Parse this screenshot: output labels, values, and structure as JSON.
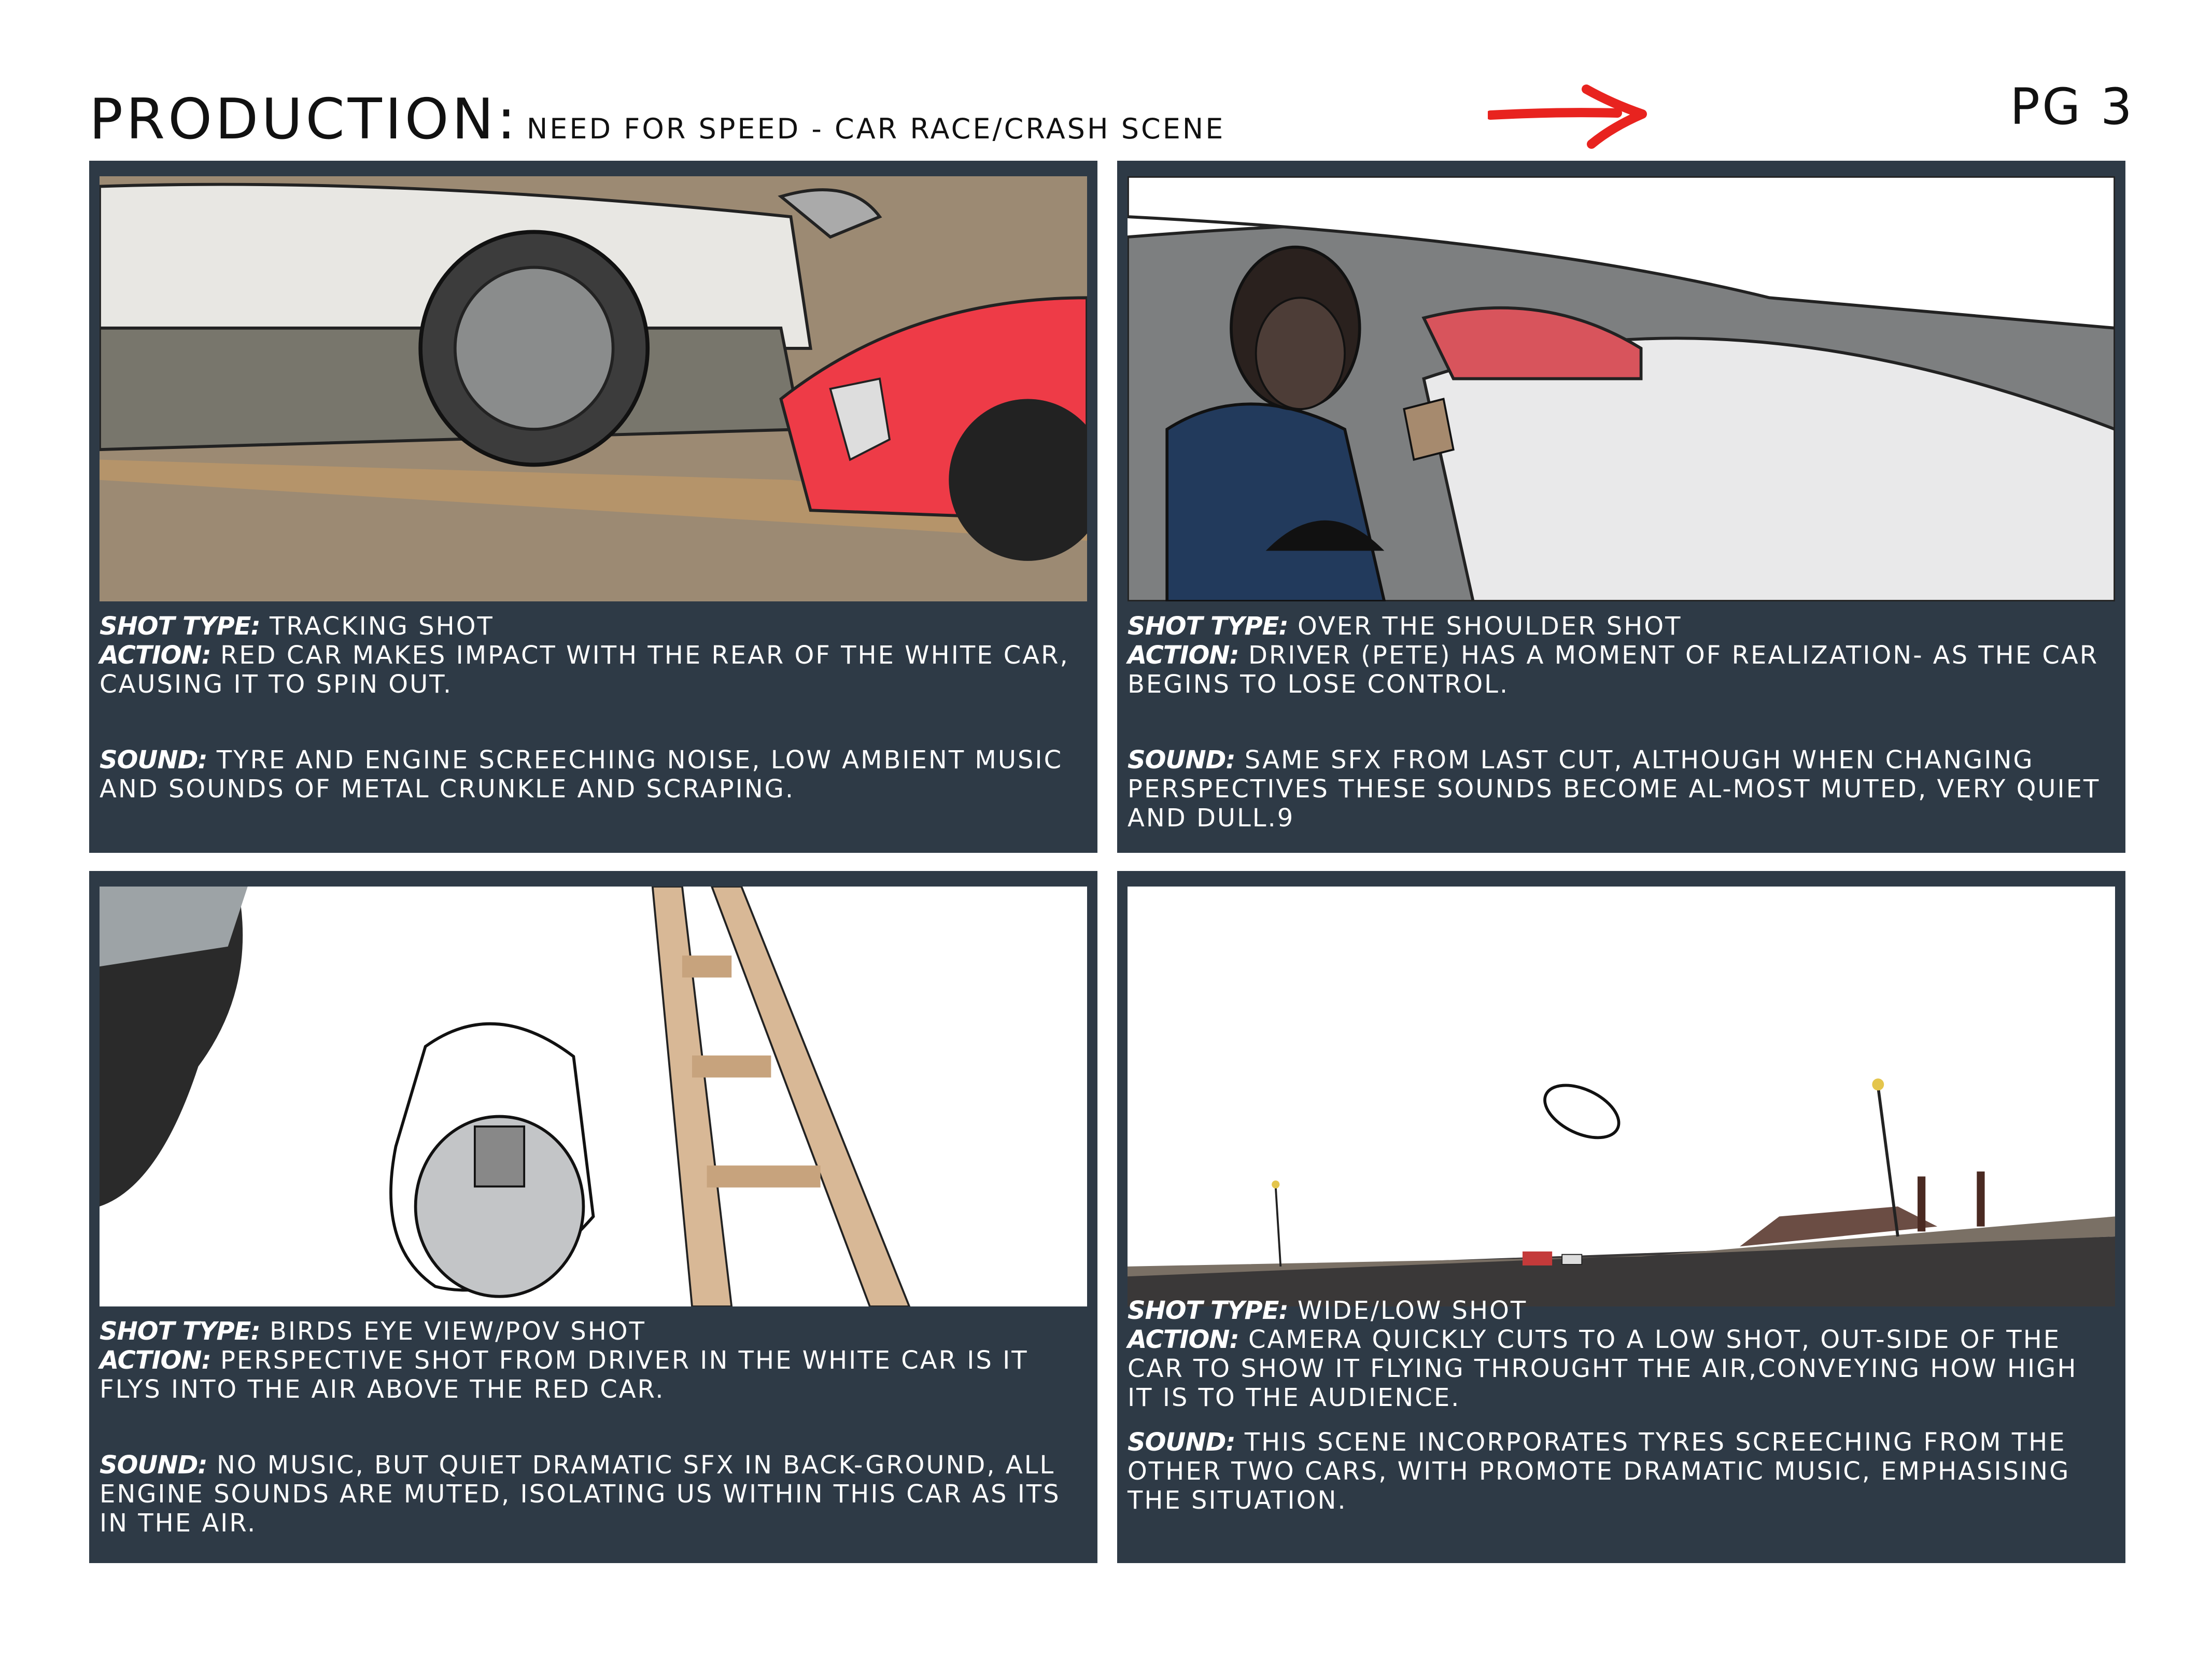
{
  "header": {
    "production_label": "PRODUCTION:",
    "scene_title": "NEED FOR SPEED - CAR RACE/CRASH SCENE",
    "page_number": "PG 3",
    "arrow_icon": "red-arrow-right-icon",
    "arrow_color": "#e8231f"
  },
  "labels": {
    "shot_type": "SHOT TYPE:",
    "action": "ACTION:",
    "sound": "SOUND:"
  },
  "panels": [
    {
      "shot_type": "TRACKING SHOT",
      "action": "RED CAR MAKES IMPACT WITH THE REAR OF THE WHITE CAR, CAUSING IT TO SPIN OUT.",
      "sound": "TYRE AND ENGINE SCREECHING NOISE, LOW AMBIENT MUSIC AND SOUNDS OF METAL CRUNKLE AND SCRAPING."
    },
    {
      "shot_type": "OVER THE SHOULDER SHOT",
      "action": "DRIVER (PETE) HAS A MOMENT OF REALIZATION- AS THE CAR BEGINS TO LOSE CONTROL.",
      "sound": "SAME SFX FROM LAST CUT,  ALTHOUGH WHEN CHANGING PERSPECTIVES THESE SOUNDS BECOME AL-MOST MUTED, VERY QUIET AND DULL.9"
    },
    {
      "shot_type": "BIRDS EYE VIEW/POV SHOT",
      "action": "PERSPECTIVE SHOT FROM DRIVER IN THE WHITE CAR IS IT FLYS INTO THE AIR ABOVE THE RED CAR.",
      "sound": "NO MUSIC, BUT QUIET DRAMATIC SFX IN BACK-GROUND, ALL ENGINE SOUNDS ARE MUTED, ISOLATING US WITHIN THIS CAR AS ITS IN THE AIR."
    },
    {
      "shot_type": "WIDE/LOW SHOT",
      "action": "CAMERA QUICKLY CUTS TO A LOW SHOT, OUT-SIDE OF THE CAR TO SHOW IT FLYING THROUGHT THE AIR,CONVEYING HOW HIGH IT IS TO THE AUDIENCE.",
      "sound": "THIS SCENE INCORPORATES TYRES SCREECHING FROM THE OTHER TWO CARS, WITH PROMOTE DRAMATIC MUSIC, EMPHASISING THE SITUATION."
    }
  ]
}
